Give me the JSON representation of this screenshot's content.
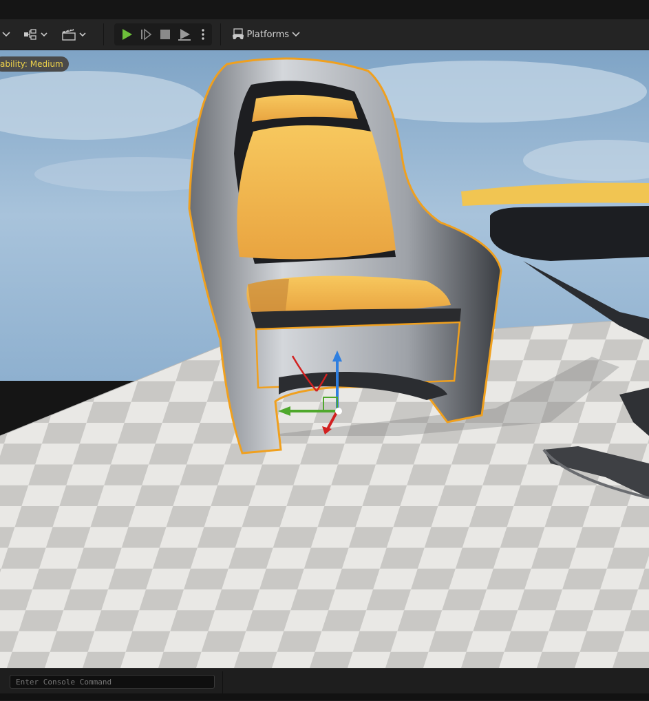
{
  "toolbar": {
    "platforms_label": "Platforms",
    "icons": [
      "select-mode-dropdown-icon",
      "blueprint-dropdown-icon",
      "cinematics-dropdown-icon",
      "play-icon",
      "step-icon",
      "stop-icon",
      "eject-icon",
      "more-options-icon",
      "platforms-icon"
    ],
    "play_color": "#6dbf3a"
  },
  "viewport": {
    "scalability_badge": "ability: Medium",
    "selection_outline_color": "#f0a01e",
    "gizmo_axes": [
      "x-red",
      "y-green",
      "z-blue"
    ]
  },
  "console": {
    "placeholder": "Enter Console Command"
  }
}
